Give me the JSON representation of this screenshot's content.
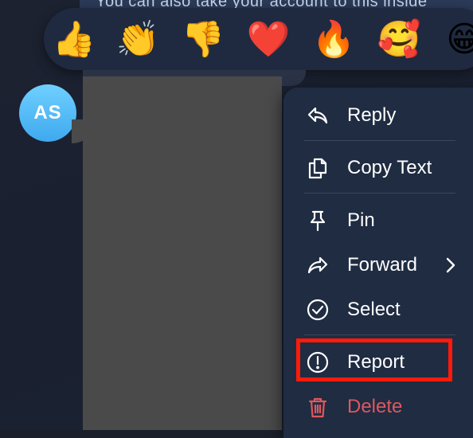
{
  "background_snippet": "You can also take your account to this inside",
  "reactions": [
    {
      "emoji": "👍",
      "name": "thumbs-up"
    },
    {
      "emoji": "👏",
      "name": "clapping-hands"
    },
    {
      "emoji": "👎",
      "name": "thumbs-down"
    },
    {
      "emoji": "❤️",
      "name": "red-heart"
    },
    {
      "emoji": "🔥",
      "name": "fire"
    },
    {
      "emoji": "🥰",
      "name": "smiling-face-with-hearts"
    },
    {
      "emoji": "😁",
      "name": "beaming-face"
    }
  ],
  "avatar": {
    "initials": "AS"
  },
  "menu": {
    "reply": "Reply",
    "copy_text": "Copy Text",
    "pin": "Pin",
    "forward": "Forward",
    "select": "Select",
    "report": "Report",
    "delete": "Delete"
  },
  "colors": {
    "menu_bg": "#1f2c42",
    "danger": "#e0575d",
    "highlight": "#ff1a0a",
    "avatar": "#4fb8f5"
  }
}
